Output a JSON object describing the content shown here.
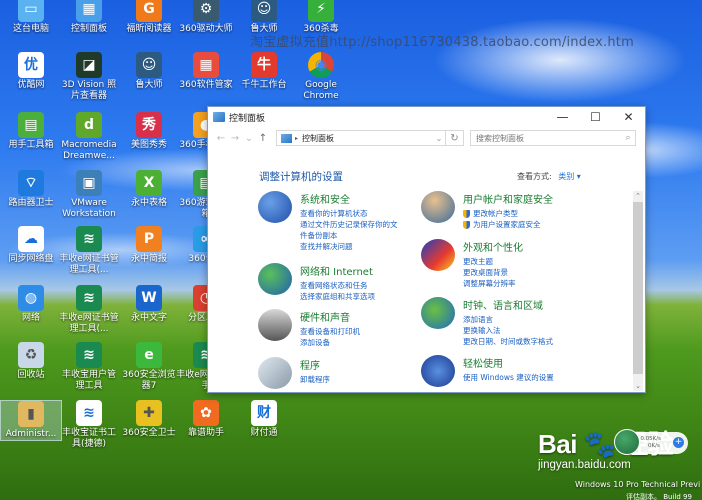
{
  "desktop": {
    "watermark": "淘宝虚拟充值http://shop116730438.taobao.com/index.htm",
    "icons": [
      {
        "label": "这台电脑",
        "icon": "computer-icon",
        "color": "#5bb2f0",
        "glyph": "▭"
      },
      {
        "label": "控制面板",
        "icon": "control-panel-icon",
        "color": "#4aa0e8",
        "glyph": "▦"
      },
      {
        "label": "福昕阅读器",
        "icon": "foxit-reader-icon",
        "color": "#f07a1a",
        "glyph": "G"
      },
      {
        "label": "360驱动大师",
        "icon": "360-driver-icon",
        "color": "#3a5a70",
        "glyph": "⚙"
      },
      {
        "label": "鲁大师",
        "icon": "ludashi-icon",
        "color": "#2d5a80",
        "glyph": "☺"
      },
      {
        "label": "360杀毒",
        "icon": "360-antivirus-icon",
        "color": "#36b03a",
        "glyph": "⚡"
      },
      {
        "label": "优酷网",
        "icon": "youku-icon",
        "color": "#ffffff",
        "glyph": "优"
      },
      {
        "label": "3D Vision 照片查看器",
        "icon": "3d-vision-icon",
        "color": "#1f3a28",
        "glyph": "◪"
      },
      {
        "label": "鲁大师",
        "icon": "ludashi-icon",
        "color": "#2d5a80",
        "glyph": "☺"
      },
      {
        "label": "360软件管家",
        "icon": "360-software-manager-icon",
        "color": "#e84c3d",
        "glyph": "▦"
      },
      {
        "label": "千牛工作台",
        "icon": "qianniu-icon",
        "color": "#e23a2c",
        "glyph": "牛"
      },
      {
        "label": "Google Chrome",
        "icon": "chrome-icon",
        "color": "#e7b325",
        "glyph": "◉"
      },
      {
        "label": "用手工具箱",
        "icon": "toolbox-icon",
        "color": "#4caf3c",
        "glyph": "▤"
      },
      {
        "label": "Macromedia Dreamwe...",
        "icon": "dreamweaver-icon",
        "color": "#5fa82a",
        "glyph": "d"
      },
      {
        "label": "美图秀秀",
        "icon": "meitu-icon",
        "color": "#d8304a",
        "glyph": "秀"
      },
      {
        "label": "360手机助手",
        "icon": "360-phone-assistant-icon",
        "color": "#f4a020",
        "glyph": "●"
      },
      {
        "label": "路由器卫士",
        "icon": "router-guard-icon",
        "color": "#1f7ae0",
        "glyph": "⌔"
      },
      {
        "label": "VMware Workstation",
        "icon": "vmware-icon",
        "color": "#3d7fb8",
        "glyph": "▣"
      },
      {
        "label": "永中表格",
        "icon": "yozo-sheet-icon",
        "color": "#4cb034",
        "glyph": "X"
      },
      {
        "label": "360游戏保险箱",
        "icon": "360-game-safe-icon",
        "color": "#3aa04a",
        "glyph": "▤"
      },
      {
        "label": "同步网络盘",
        "icon": "sync-disk-icon",
        "color": "#ffffff",
        "glyph": "☁"
      },
      {
        "label": "丰收e网证书管理工具(...",
        "icon": "fengshou-cert-icon",
        "color": "#1a8a50",
        "glyph": "≋"
      },
      {
        "label": "永中简报",
        "icon": "yozo-presentation-icon",
        "color": "#f08020",
        "glyph": "P"
      },
      {
        "label": "360云盘",
        "icon": "360-cloud-icon",
        "color": "#2a9be6",
        "glyph": "∞"
      },
      {
        "label": "网络",
        "icon": "network-icon",
        "color": "#2f8ce6",
        "glyph": "◍"
      },
      {
        "label": "丰收e网证书管理工具(...",
        "icon": "fengshou-cert-icon",
        "color": "#1a8a50",
        "glyph": "≋"
      },
      {
        "label": "永中文字",
        "icon": "yozo-writer-icon",
        "color": "#1a66cc",
        "glyph": "W"
      },
      {
        "label": "分区助手",
        "icon": "partition-assistant-icon",
        "color": "#d84030",
        "glyph": "◔"
      },
      {
        "label": "回收站",
        "icon": "recycle-bin-icon",
        "color": "#c8d8e8",
        "glyph": "♻"
      },
      {
        "label": "丰收宝用户管理工具",
        "icon": "fengshou-user-icon",
        "color": "#1a8a50",
        "glyph": "≋"
      },
      {
        "label": "360安全浏览器7",
        "icon": "360-browser-icon",
        "color": "#3cb83c",
        "glyph": "e"
      },
      {
        "label": "丰收e网网银助手",
        "icon": "fengshou-bank-icon",
        "color": "#1a8a50",
        "glyph": "≋"
      },
      {
        "label": "Administr...",
        "icon": "user-folder-icon",
        "color": "#e0b860",
        "glyph": "▮"
      },
      {
        "label": "丰收宝证书工具(捷德)",
        "icon": "fengshou-cert-tool-icon",
        "color": "#ffffff",
        "glyph": "≋"
      },
      {
        "label": "360安全卫士",
        "icon": "360-security-icon",
        "color": "#e8c020",
        "glyph": "✚"
      },
      {
        "label": "靠谱助手",
        "icon": "kaopu-assistant-icon",
        "color": "#f06a20",
        "glyph": "✿"
      },
      {
        "label": "财付通",
        "icon": "tenpay-icon",
        "color": "#ffffff",
        "glyph": "财"
      }
    ]
  },
  "window": {
    "title": "控制面板",
    "buttons": {
      "minimize": "—",
      "maximize": "☐",
      "close": "✕"
    },
    "nav": {
      "back": "←",
      "forward": "→",
      "recent": "⌄",
      "up": "↑"
    },
    "address": {
      "separator": "▸",
      "path": "控制面板",
      "dropdown": "⌄",
      "refresh": "↻"
    },
    "search": {
      "placeholder": "搜索控制面板",
      "value": "",
      "icon": "⌕"
    },
    "heading": "调整计算机的设置",
    "view_by": {
      "label": "查看方式:",
      "value": "类别 ▾"
    },
    "categories": [
      {
        "title": "系统和安全",
        "icon": "system-security-icon",
        "links": [
          {
            "text": "查看你的计算机状态",
            "shield": false
          },
          {
            "text": "通过文件历史记录保存你的文",
            "shield": false
          },
          {
            "text": "件备份副本",
            "shield": false
          },
          {
            "text": "查找并解决问题",
            "shield": false
          }
        ]
      },
      {
        "title": "网络和 Internet",
        "icon": "network-internet-icon",
        "links": [
          {
            "text": "查看网络状态和任务",
            "shield": false
          },
          {
            "text": "选择家庭组和共享选项",
            "shield": false
          }
        ]
      },
      {
        "title": "硬件和声音",
        "icon": "hardware-sound-icon",
        "links": [
          {
            "text": "查看设备和打印机",
            "shield": false
          },
          {
            "text": "添加设备",
            "shield": false
          }
        ]
      },
      {
        "title": "程序",
        "icon": "programs-icon",
        "links": [
          {
            "text": "卸载程序",
            "shield": false
          }
        ]
      },
      {
        "title": "用户帐户和家庭安全",
        "icon": "user-accounts-icon",
        "links": [
          {
            "text": "更改帐户类型",
            "shield": true
          },
          {
            "text": "为用户设置家庭安全",
            "shield": true
          }
        ]
      },
      {
        "title": "外观和个性化",
        "icon": "appearance-icon",
        "links": [
          {
            "text": "更改主题",
            "shield": false
          },
          {
            "text": "更改桌面背景",
            "shield": false
          },
          {
            "text": "调整屏幕分辨率",
            "shield": false
          }
        ]
      },
      {
        "title": "时钟、语言和区域",
        "icon": "clock-language-icon",
        "links": [
          {
            "text": "添加语言",
            "shield": false
          },
          {
            "text": "更换输入法",
            "shield": false
          },
          {
            "text": "更改日期、时间或数字格式",
            "shield": false
          }
        ]
      },
      {
        "title": "轻松使用",
        "icon": "ease-of-access-icon",
        "links": [
          {
            "text": "使用 Windows 建议的设置",
            "shield": false
          }
        ]
      }
    ],
    "scrollbar": {
      "up": "⌃",
      "down": "⌄"
    }
  },
  "overlay": {
    "baidu_logo": "Bai 🐾 经验",
    "baidu_url": "jingyan.baidu.com",
    "net_up": "↑ 0.05K/s",
    "net_down": "0K/s",
    "net_plus": "+",
    "os_build": "Windows 10 Pro Technical Previ",
    "os_build_line2": "评估副本。 Build 99"
  }
}
